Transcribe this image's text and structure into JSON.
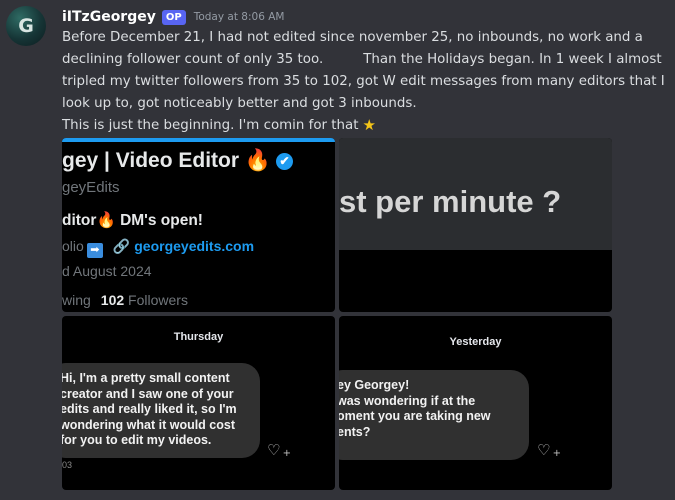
{
  "author": {
    "avatar_letter": "G",
    "username": "iITzGeorgey",
    "badge": "OP",
    "timestamp": "Today at 8:06 AM"
  },
  "message": {
    "lines": [
      "Before December 21, I had not edited since november 25, no inbounds, no work and a",
      "declining follower count of only 35 too.",
      "Than the Holidays began. In 1 week I almost",
      "tripled my twitter followers from 35 to 102, got W edit messages from many editors that I",
      "look up to, got noticeably better and got 3 inbounds.",
      "This is just the beginning. I'm comin for that"
    ],
    "emoji_name": "star-emoji",
    "emoji_glyph": "★"
  },
  "attachments": {
    "profile": {
      "title": "gey | Video Editor",
      "fire_glyph": "🔥",
      "verified_glyph": "✔",
      "handle": "geyEdits",
      "bio_prefix": "ditor",
      "bio_suffix": "DM's open!",
      "portfolio_label": "olio",
      "arrow_glyph": "➡",
      "link_glyph": "🔗",
      "link": "georgeyedits.com",
      "joined": "d August 2024",
      "following_label": "wing",
      "followers_count": "102",
      "followers_label": "Followers"
    },
    "headline": {
      "text": "st per minute ?"
    },
    "dm_thursday": {
      "day": "Thursday",
      "lines": [
        "Hi, I'm a pretty small content",
        "creator and I saw one of your",
        "edits and really liked it, so I'm",
        "wondering what it would cost",
        "for you to edit my videos."
      ],
      "footer": "03"
    },
    "dm_yesterday": {
      "day": "Yesterday",
      "lines": [
        "ey Georgey!",
        "was wondering if at the",
        "oment you are taking new",
        "ents?"
      ]
    },
    "react_glyph": "♡",
    "react_plus": "+"
  },
  "colors": {
    "background": "#323339",
    "text": "#dbdee1",
    "username": "#ffffff",
    "op_badge": "#5865f2",
    "timestamp": "#949ba4",
    "twitter_blue": "#1d9bf0",
    "tile_bg": "#000000"
  }
}
